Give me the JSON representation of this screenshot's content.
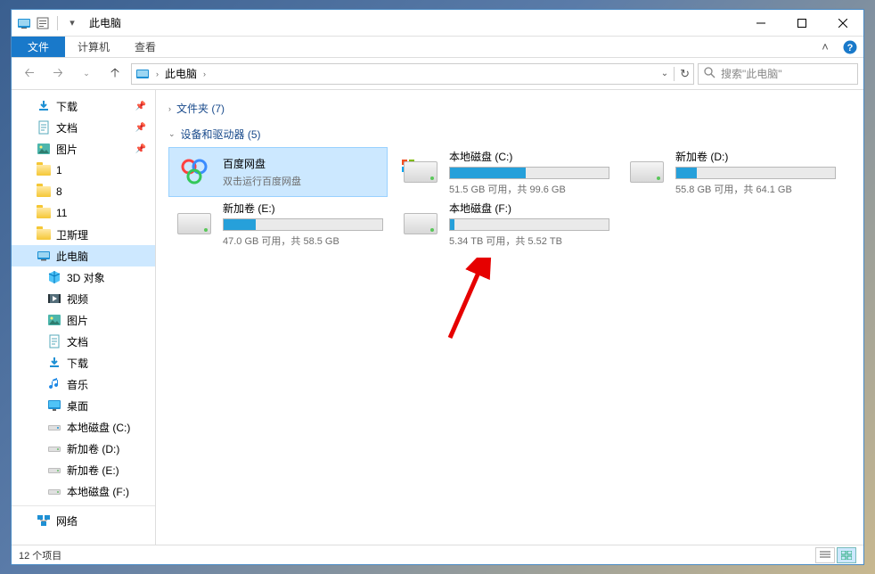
{
  "title": "此电脑",
  "tabs": {
    "file": "文件",
    "computer": "计算机",
    "view": "查看"
  },
  "nav": {
    "location": "此电脑",
    "refresh_title": "刷新"
  },
  "search": {
    "placeholder": "搜索\"此电脑\""
  },
  "sidebar": {
    "items": [
      {
        "icon": "download",
        "label": "下载",
        "pinned": true
      },
      {
        "icon": "document",
        "label": "文档",
        "pinned": true
      },
      {
        "icon": "picture",
        "label": "图片",
        "pinned": true
      },
      {
        "icon": "folder",
        "label": "1"
      },
      {
        "icon": "folder",
        "label": "8"
      },
      {
        "icon": "folder",
        "label": "11"
      },
      {
        "icon": "folder",
        "label": "卫斯理"
      }
    ],
    "this_pc": "此电脑",
    "pc_children": [
      {
        "icon": "3d",
        "label": "3D 对象"
      },
      {
        "icon": "video",
        "label": "视频"
      },
      {
        "icon": "picture",
        "label": "图片"
      },
      {
        "icon": "document",
        "label": "文档"
      },
      {
        "icon": "download",
        "label": "下载"
      },
      {
        "icon": "music",
        "label": "音乐"
      },
      {
        "icon": "desktop",
        "label": "桌面"
      },
      {
        "icon": "drive-c",
        "label": "本地磁盘 (C:)"
      },
      {
        "icon": "drive",
        "label": "新加卷 (D:)"
      },
      {
        "icon": "drive",
        "label": "新加卷 (E:)"
      },
      {
        "icon": "drive",
        "label": "本地磁盘 (F:)"
      }
    ],
    "network": "网络"
  },
  "groups": {
    "folders": {
      "label": "文件夹 (7)",
      "expanded": false
    },
    "drives": {
      "label": "设备和驱动器 (5)",
      "expanded": true
    }
  },
  "drives": [
    {
      "type": "app",
      "name": "百度网盘",
      "sub": "双击运行百度网盘",
      "selected": true
    },
    {
      "type": "osdrive",
      "name": "本地磁盘 (C:)",
      "free_text": "51.5 GB 可用，共 99.6 GB",
      "fill_pct": 48
    },
    {
      "type": "drive",
      "name": "新加卷 (D:)",
      "free_text": "55.8 GB 可用，共 64.1 GB",
      "fill_pct": 13
    },
    {
      "type": "drive",
      "name": "新加卷 (E:)",
      "free_text": "47.0 GB 可用，共 58.5 GB",
      "fill_pct": 20
    },
    {
      "type": "drive",
      "name": "本地磁盘 (F:)",
      "free_text": "5.34 TB 可用，共 5.52 TB",
      "fill_pct": 3
    }
  ],
  "status": {
    "text": "12 个项目"
  }
}
